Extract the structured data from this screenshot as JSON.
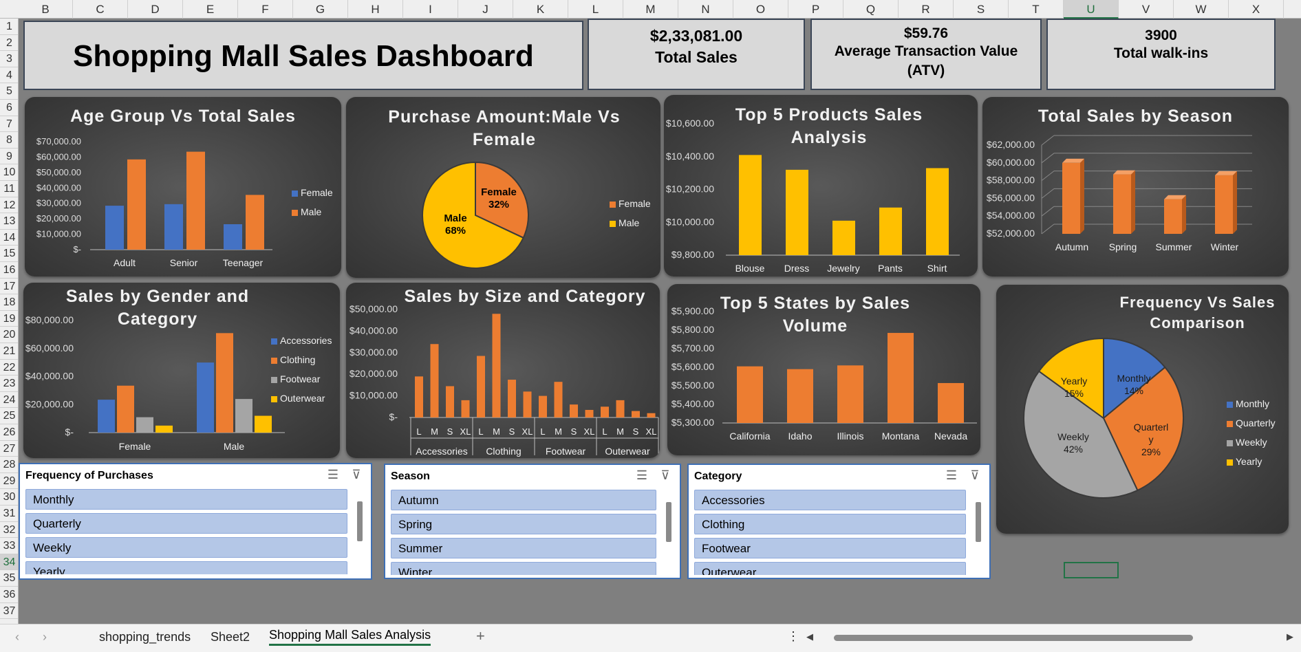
{
  "columns": [
    "B",
    "C",
    "D",
    "E",
    "F",
    "G",
    "H",
    "I",
    "J",
    "K",
    "L",
    "M",
    "N",
    "O",
    "P",
    "Q",
    "R",
    "S",
    "T",
    "U",
    "V",
    "W",
    "X"
  ],
  "selected_column": "U",
  "rows": [
    "1",
    "2",
    "3",
    "4",
    "5",
    "6",
    "7",
    "8",
    "9",
    "10",
    "11",
    "12",
    "13",
    "14",
    "15",
    "16",
    "17",
    "18",
    "19",
    "20",
    "21",
    "22",
    "23",
    "24",
    "25",
    "26",
    "27",
    "28",
    "29",
    "30",
    "31",
    "32",
    "33",
    "34",
    "35",
    "36",
    "37"
  ],
  "selected_row": "34",
  "dashboard_title": "Shopping Mall Sales Dashboard",
  "kpis": {
    "total_sales": {
      "value": "$2,33,081.00",
      "label": "Total Sales"
    },
    "atv": {
      "value": "$59.76",
      "label": "Average Transaction Value (ATV)"
    },
    "walkins": {
      "value": "3900",
      "label": "Total walk-ins"
    }
  },
  "colors": {
    "blue": "#4472c4",
    "orange": "#ed7d31",
    "gray": "#a5a5a5",
    "yellow": "#ffc000",
    "panel": "#404040"
  },
  "chart_data": [
    {
      "id": "age",
      "type": "bar",
      "title": "Age Group Vs Total Sales",
      "categories": [
        "Adult",
        "Senior",
        "Teenager"
      ],
      "series": [
        {
          "name": "Female",
          "values": [
            28500,
            29500,
            16500
          ]
        },
        {
          "name": "Male",
          "values": [
            58500,
            63500,
            35500
          ]
        }
      ],
      "ylim": [
        0,
        70000
      ],
      "yticks": [
        "$70,000.00",
        "$60,000.00",
        "$50,000.00",
        "$40,000.00",
        "$30,000.00",
        "$20,000.00",
        "$10,000.00",
        "$-"
      ],
      "legend": "right"
    },
    {
      "id": "gender_pie",
      "type": "pie",
      "title": "Purchase Amount:Male Vs Female",
      "slices": [
        {
          "name": "Female",
          "value": 32,
          "label": "32%"
        },
        {
          "name": "Male",
          "value": 68,
          "label": "68%"
        }
      ],
      "legend": "right"
    },
    {
      "id": "products",
      "type": "bar",
      "title": "Top 5 Products Sales Analysis",
      "categories": [
        "Blouse",
        "Dress",
        "Jewelry",
        "Pants",
        "Shirt"
      ],
      "values": [
        10410,
        10320,
        10010,
        10090,
        10330
      ],
      "ylim": [
        9800,
        10600
      ],
      "yticks": [
        "$10,600.00",
        "$10,400.00",
        "$10,200.00",
        "$10,000.00",
        "$9,800.00"
      ]
    },
    {
      "id": "season",
      "type": "bar",
      "title": "Total Sales by Season",
      "categories": [
        "Autumn",
        "Spring",
        "Summer",
        "Winter"
      ],
      "values": [
        60000,
        58700,
        55900,
        58600
      ],
      "ylim": [
        52000,
        62000
      ],
      "yticks": [
        "$62,000.00",
        "$60,000.00",
        "$58,000.00",
        "$56,000.00",
        "$54,000.00",
        "$52,000.00"
      ]
    },
    {
      "id": "gender_cat",
      "type": "bar",
      "title": "Sales by Gender and Category",
      "categories": [
        "Female",
        "Male"
      ],
      "series": [
        {
          "name": "Accessories",
          "values": [
            23500,
            50000
          ]
        },
        {
          "name": "Clothing",
          "values": [
            33500,
            71000
          ]
        },
        {
          "name": "Footwear",
          "values": [
            11000,
            24000
          ]
        },
        {
          "name": "Outerwear",
          "values": [
            5000,
            12000
          ]
        }
      ],
      "ylim": [
        0,
        80000
      ],
      "yticks": [
        "$80,000.00",
        "$60,000.00",
        "$40,000.00",
        "$20,000.00",
        "$-"
      ],
      "legend": "right"
    },
    {
      "id": "size_cat",
      "type": "bar",
      "title": "Sales by Size and Category",
      "groups": [
        {
          "name": "Accessories",
          "sizes": [
            "L",
            "M",
            "S",
            "XL"
          ],
          "values": [
            19000,
            34000,
            14500,
            8000
          ]
        },
        {
          "name": "Clothing",
          "sizes": [
            "L",
            "M",
            "S",
            "XL"
          ],
          "values": [
            28500,
            48000,
            17500,
            12000
          ]
        },
        {
          "name": "Footwear",
          "sizes": [
            "L",
            "M",
            "S",
            "XL"
          ],
          "values": [
            10000,
            16500,
            6000,
            3500
          ]
        },
        {
          "name": "Outerwear",
          "sizes": [
            "L",
            "M",
            "S",
            "XL"
          ],
          "values": [
            5000,
            8000,
            3000,
            2000
          ]
        }
      ],
      "ylim": [
        0,
        50000
      ],
      "yticks": [
        "$50,000.00",
        "$40,000.00",
        "$30,000.00",
        "$20,000.00",
        "$10,000.00",
        "$-"
      ]
    },
    {
      "id": "states",
      "type": "bar",
      "title": "Top 5 States by Sales Volume",
      "categories": [
        "California",
        "Idaho",
        "Illinois",
        "Montana",
        "Nevada"
      ],
      "values": [
        5605,
        5590,
        5610,
        5785,
        5515
      ],
      "ylim": [
        5300,
        5900
      ],
      "yticks": [
        "$5,900.00",
        "$5,800.00",
        "$5,700.00",
        "$5,600.00",
        "$5,500.00",
        "$5,400.00",
        "$5,300.00"
      ]
    },
    {
      "id": "freq_pie",
      "type": "pie",
      "title": "Frequency Vs Sales Comparison",
      "slices": [
        {
          "name": "Monthly",
          "value": 14,
          "label": "14%"
        },
        {
          "name": "Quarterly",
          "value": 29,
          "label": "29%"
        },
        {
          "name": "Weekly",
          "value": 42,
          "label": "42%"
        },
        {
          "name": "Yearly",
          "value": 15,
          "label": "15%"
        }
      ],
      "legend": "right"
    }
  ],
  "slicers": [
    {
      "title": "Frequency of Purchases",
      "items": [
        "Monthly",
        "Quarterly",
        "Weekly",
        "Yearly"
      ]
    },
    {
      "title": "Season",
      "items": [
        "Autumn",
        "Spring",
        "Summer",
        "Winter"
      ]
    },
    {
      "title": "Category",
      "items": [
        "Accessories",
        "Clothing",
        "Footwear",
        "Outerwear"
      ]
    }
  ],
  "sheet_tabs": [
    "shopping_trends",
    "Sheet2",
    "Shopping Mall Sales Analysis"
  ],
  "active_tab": "Shopping Mall Sales Analysis",
  "nav": {
    "prev": "‹",
    "next": "›",
    "add": "+",
    "more": "⋮",
    "scroll_left": "◀",
    "scroll_right": "▶"
  }
}
